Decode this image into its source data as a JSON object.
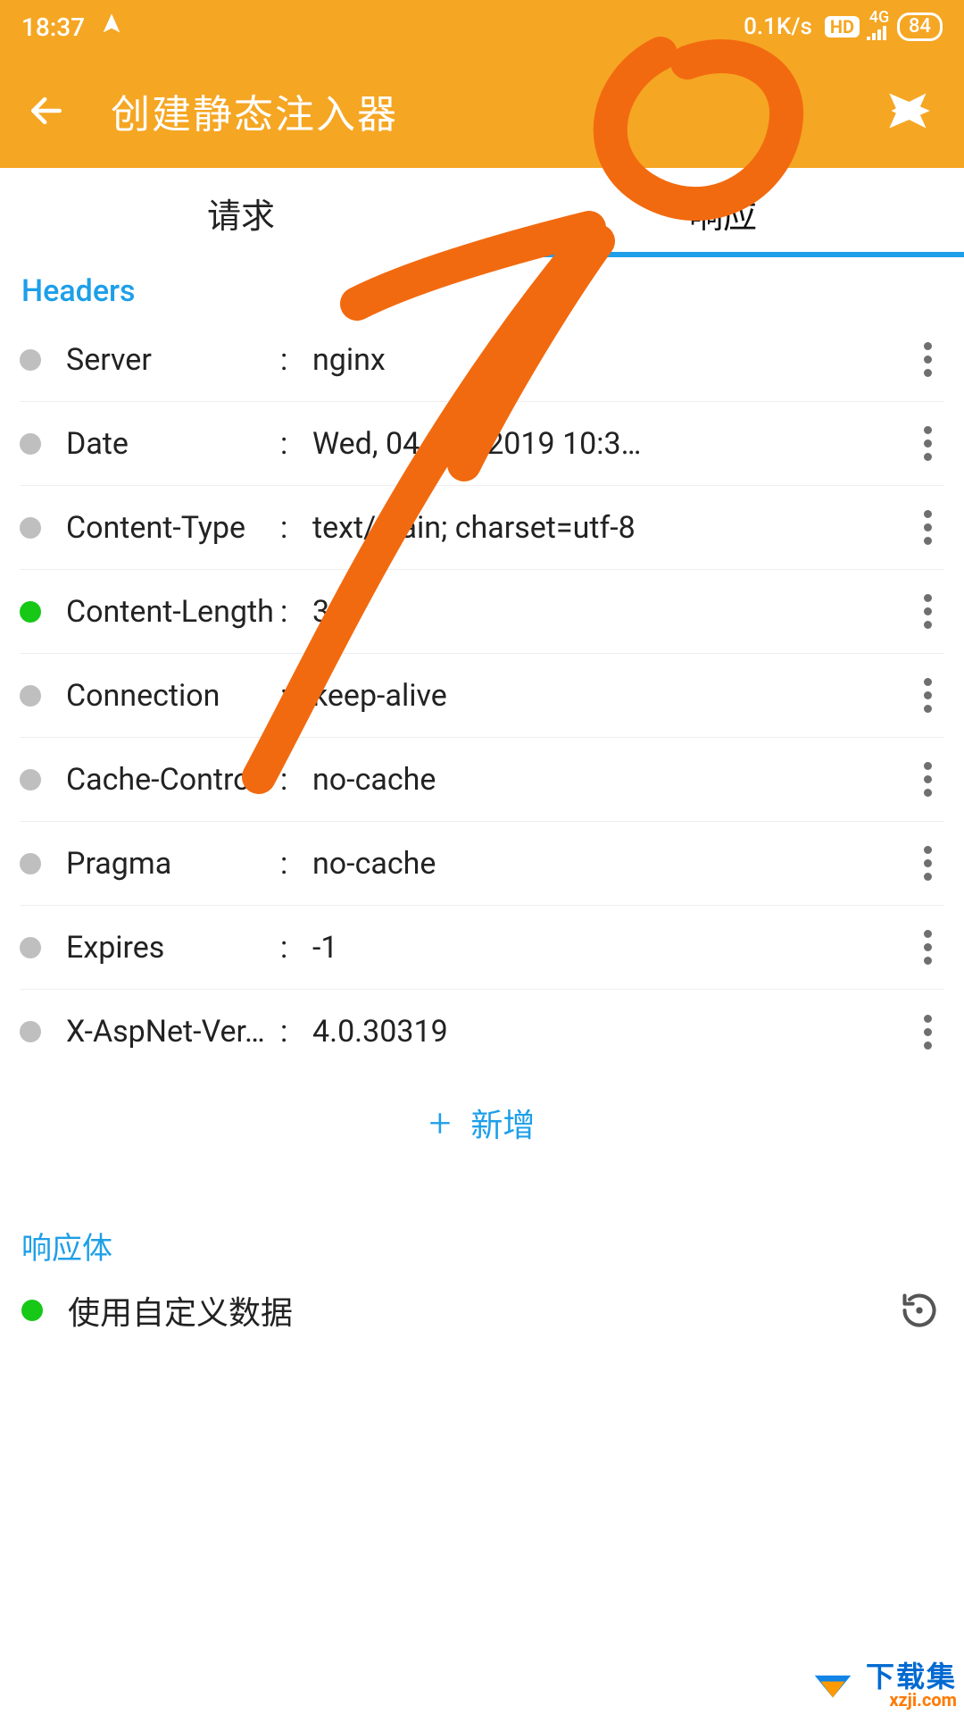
{
  "status": {
    "time": "18:37",
    "net_speed": "0.1K/s",
    "hd": "HD",
    "net_type": "4G",
    "battery": "84"
  },
  "appbar": {
    "title": "创建静态注入器"
  },
  "tabs": {
    "request": "请求",
    "response": "响应",
    "active": "response"
  },
  "sections": {
    "headers_title": "Headers",
    "add_label": "新增",
    "body_title": "响应体",
    "custom_data_label": "使用自定义数据"
  },
  "headers": [
    {
      "key": "Server",
      "value": "nginx",
      "highlight": false
    },
    {
      "key": "Date",
      "value": "Wed, 04 Dec 2019 10:3…",
      "highlight": false
    },
    {
      "key": "Content-Type",
      "value": "text/plain; charset=utf-8",
      "highlight": false
    },
    {
      "key": "Content-Length",
      "value": "32",
      "highlight": true
    },
    {
      "key": "Connection",
      "value": "keep-alive",
      "highlight": false
    },
    {
      "key": "Cache-Control",
      "value": "no-cache",
      "highlight": false
    },
    {
      "key": "Pragma",
      "value": "no-cache",
      "highlight": false
    },
    {
      "key": "Expires",
      "value": "-1",
      "highlight": false
    },
    {
      "key": "X-AspNet-Ver…",
      "value": "4.0.30319",
      "highlight": false
    }
  ],
  "watermark": {
    "cn": "下载集",
    "url": "xzji.com"
  },
  "colors": {
    "accent": "#F5A623",
    "link": "#1E9FE8",
    "green": "#17c817"
  }
}
